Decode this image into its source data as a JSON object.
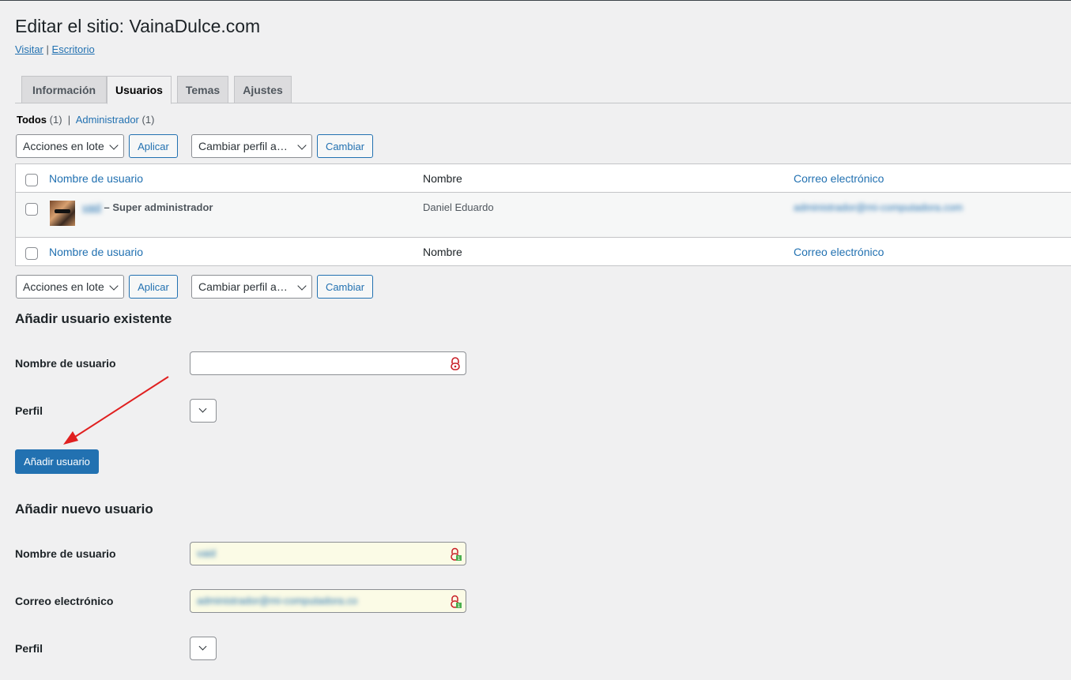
{
  "header": {
    "title": "Editar el sitio: VainaDulce.com",
    "visit_link": "Visitar",
    "separator": "|",
    "dashboard_link": "Escritorio"
  },
  "tabs": [
    {
      "label": "Información"
    },
    {
      "label": "Usuarios",
      "active": true
    },
    {
      "label": "Temas"
    },
    {
      "label": "Ajustes"
    }
  ],
  "filters": {
    "all_label": "Todos",
    "all_count": "(1)",
    "separator": "|",
    "admin_label": "Administrador",
    "admin_count": "(1)"
  },
  "bulk": {
    "actions_selected": "Acciones en lote",
    "apply_label": "Aplicar",
    "role_selected": "Cambiar perfil a…",
    "change_label": "Cambiar"
  },
  "table": {
    "columns": {
      "username": "Nombre de usuario",
      "name": "Nombre",
      "email": "Correo electrónico"
    },
    "rows": [
      {
        "username": "vaid",
        "role_suffix": "– Super administrador",
        "name": "Daniel Eduardo",
        "email": "administrador@mi-computadora.com"
      }
    ]
  },
  "add_existing": {
    "heading": "Añadir usuario existente",
    "username_label": "Nombre de usuario",
    "username_value": "",
    "role_label": "Perfil",
    "submit_label": "Añadir usuario"
  },
  "add_new": {
    "heading": "Añadir nuevo usuario",
    "username_label": "Nombre de usuario",
    "username_value": "vaid",
    "email_label": "Correo electrónico",
    "email_value": "administrador@mi-computadora.co",
    "role_label": "Perfil"
  },
  "colors": {
    "link": "#2271b1",
    "primary": "#2271b1",
    "background": "#f0f0f1",
    "arrow": "#e02020",
    "autofill": "#fbfbe6"
  }
}
